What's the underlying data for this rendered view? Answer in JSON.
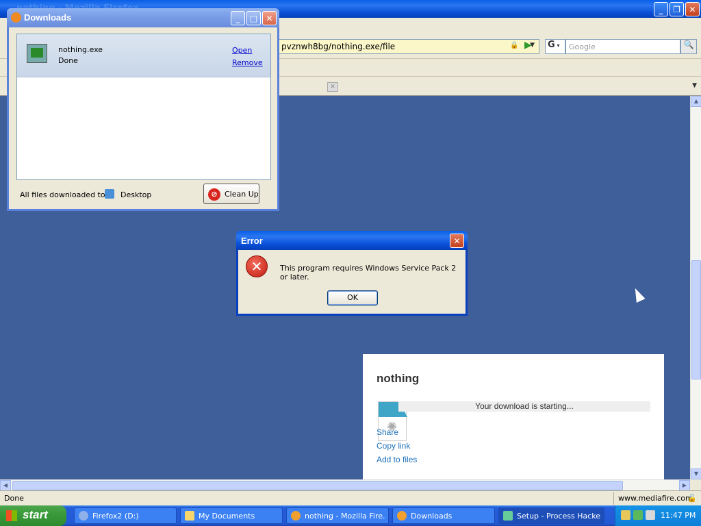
{
  "firefox": {
    "title": "nothing - Mozilla Firefox",
    "url": "pvznwh8bg/nothing.exe/file",
    "search_engine": "G",
    "search_placeholder": "Google",
    "status": "Done",
    "status_site": "www.mediafire.com"
  },
  "page": {
    "file_title": "nothing",
    "download_status": "Your download is starting...",
    "share": "Share",
    "copy_link": "Copy link",
    "add_to_files": "Add to files"
  },
  "downloads": {
    "title": "Downloads",
    "item_name": "nothing.exe",
    "item_status": "Done",
    "open": "Open",
    "remove": "Remove",
    "footer_label": "All files downloaded to:",
    "folder": "Desktop",
    "cleanup": "Clean Up"
  },
  "error": {
    "title": "Error",
    "message": "This program requires Windows Service Pack 2 or later.",
    "ok": "OK"
  },
  "taskbar": {
    "start": "start",
    "tasks": [
      {
        "label": "Firefox2 (D:)"
      },
      {
        "label": "My Documents"
      },
      {
        "label": "nothing - Mozilla Fire..."
      },
      {
        "label": "Downloads"
      },
      {
        "label": "Setup - Process Hacker"
      }
    ],
    "clock": "11:47 PM"
  },
  "colors": {
    "page_bg": "#3f5f9a",
    "xp_blue": "#245edb",
    "start_green": "#3a9b3a",
    "link_blue": "#1f72b8"
  }
}
